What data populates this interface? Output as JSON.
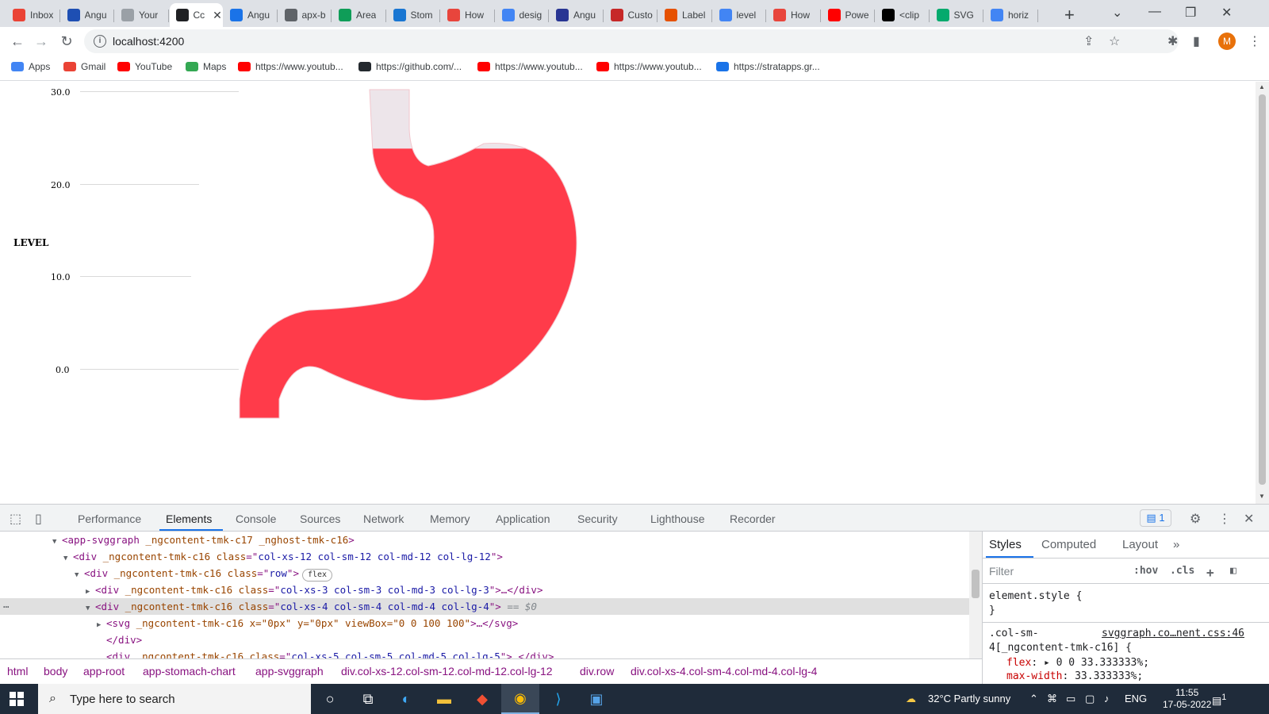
{
  "browser": {
    "tabs": [
      {
        "title": "Inbox",
        "icon": "gmail-icon",
        "color": "#ea4335"
      },
      {
        "title": "Angu",
        "icon": "grid-icon",
        "color": "#1e4fb3"
      },
      {
        "title": "Your",
        "icon": "gear-icon",
        "color": "#9aa0a6"
      },
      {
        "title": "Cc",
        "icon": "angular-icon",
        "color": "#202124"
      },
      {
        "title": "Angu",
        "icon": "angular-material-icon",
        "color": "#1a73e8"
      },
      {
        "title": "apx-b",
        "icon": "square-icon",
        "color": "#5f6368"
      },
      {
        "title": "Area",
        "icon": "sheet-icon",
        "color": "#0f9d58"
      },
      {
        "title": "Stom",
        "icon": "stackblitz-icon",
        "color": "#1976d2"
      },
      {
        "title": "How",
        "icon": "asterisk-icon",
        "color": "#e8453c"
      },
      {
        "title": "desig",
        "icon": "google-icon",
        "color": "#4285f4"
      },
      {
        "title": "Angu",
        "icon": "hi-icon",
        "color": "#283593"
      },
      {
        "title": "Custo",
        "icon": "flag-icon",
        "color": "#c62828"
      },
      {
        "title": "Label",
        "icon": "label-icon",
        "color": "#e65100"
      },
      {
        "title": "level",
        "icon": "google-icon",
        "color": "#4285f4"
      },
      {
        "title": "How",
        "icon": "asterisk-icon",
        "color": "#e8453c"
      },
      {
        "title": "Powe",
        "icon": "youtube-icon",
        "color": "#ff0000"
      },
      {
        "title": "<clip",
        "icon": "medium-icon",
        "color": "#000000"
      },
      {
        "title": "SVG",
        "icon": "w3-icon",
        "color": "#04aa6d"
      },
      {
        "title": "horiz",
        "icon": "google-icon",
        "color": "#4285f4"
      }
    ],
    "active_tab_index": 3,
    "new_tab_label": "+",
    "url": "localhost:4200",
    "profile_initial": "M",
    "bookmarks": [
      {
        "label": "Apps",
        "icon": "apps-grid-icon",
        "color": "#4285f4"
      },
      {
        "label": "Gmail",
        "icon": "gmail-icon",
        "color": "#ea4335"
      },
      {
        "label": "YouTube",
        "icon": "youtube-icon",
        "color": "#ff0000"
      },
      {
        "label": "Maps",
        "icon": "maps-icon",
        "color": "#34a853"
      },
      {
        "label": "https://www.youtub...",
        "icon": "youtube-icon",
        "color": "#ff0000"
      },
      {
        "label": "https://github.com/...",
        "icon": "github-icon",
        "color": "#24292e"
      },
      {
        "label": "https://www.youtub...",
        "icon": "youtube-icon",
        "color": "#ff0000"
      },
      {
        "label": "https://www.youtub...",
        "icon": "youtube-icon",
        "color": "#ff0000"
      },
      {
        "label": "https://stratapps.gr...",
        "icon": "cloud-icon",
        "color": "#1a73e8"
      }
    ]
  },
  "chart_data": {
    "type": "area",
    "ylabel": "LEVEL",
    "y_ticks": [
      "30.0",
      "20.0",
      "10.0",
      "0.0"
    ],
    "ylim": [
      0,
      30
    ],
    "fill_level": 19,
    "fill_color": "#ff3b4a",
    "empty_color": "#ede5ea"
  },
  "devtools": {
    "tabs": [
      "Performance",
      "Elements",
      "Console",
      "Sources",
      "Network",
      "Memory",
      "Application",
      "Security",
      "Lighthouse",
      "Recorder"
    ],
    "active_tab": "Elements",
    "issues_count": "1",
    "dom_lines": [
      {
        "tag": "app-svggraph",
        "attrs": " _ngcontent-tmk-c17 _nghost-tmk-c16",
        "suffix": ">"
      },
      {
        "tag": "div",
        "attrs": " _ngcontent-tmk-c16 ",
        "class": "col-xs-12 col-sm-12 col-md-12 col-lg-12",
        "suffix": ">"
      },
      {
        "tag": "div",
        "attrs": " _ngcontent-tmk-c16 ",
        "class": "row",
        "suffix": ">",
        "badge": "flex"
      },
      {
        "tag": "div",
        "attrs": " _ngcontent-tmk-c16 ",
        "class": "col-xs-3 col-sm-3 col-md-3 col-lg-3",
        "suffix": ">…</div>"
      },
      {
        "tag": "div",
        "attrs": " _ngcontent-tmk-c16 ",
        "class": "col-xs-4 col-sm-4 col-md-4 col-lg-4",
        "suffix": ">",
        "note": " == $0"
      },
      {
        "tag": "svg",
        "attrs": " _ngcontent-tmk-c16 x=\"0px\" y=\"0px\" viewBox=\"0 0 100 100\"",
        "suffix": ">…</svg>"
      },
      {
        "tag": "/div",
        "attrs": "",
        "suffix": ">"
      },
      {
        "tag": "div",
        "attrs": " _ngcontent-tmk-c16 ",
        "class": "col-xs-5 col-sm-5 col-md-5 col-lg-5",
        "suffix": ">…</div>"
      }
    ],
    "breadcrumbs": [
      "html",
      "body",
      "app-root",
      "app-stomach-chart",
      "app-svggraph",
      "div.col-xs-12.col-sm-12.col-md-12.col-lg-12",
      "div.row",
      "div.col-xs-4.col-sm-4.col-md-4.col-lg-4"
    ],
    "styles": {
      "tabs": [
        "Styles",
        "Computed",
        "Layout"
      ],
      "filter_placeholder": "Filter",
      "hov": ":hov",
      "cls": ".cls",
      "element_style": "element.style {",
      "close_brace": "}",
      "rule_selector_1": ".col-sm-",
      "rule_selector_2": "4[_ngcontent-tmk-c16] {",
      "rule_source": "svggraph.co…nent.css:46",
      "prop1_name": "flex",
      "prop1_value": "0 0 33.333333%;",
      "prop2_name": "max-width",
      "prop2_value": "33.333333%;"
    }
  },
  "taskbar": {
    "search_placeholder": "Type here to search",
    "weather": "32°C  Partly sunny",
    "lang": "ENG",
    "time": "11:55",
    "date": "17-05-2022",
    "notification_count": "1"
  }
}
